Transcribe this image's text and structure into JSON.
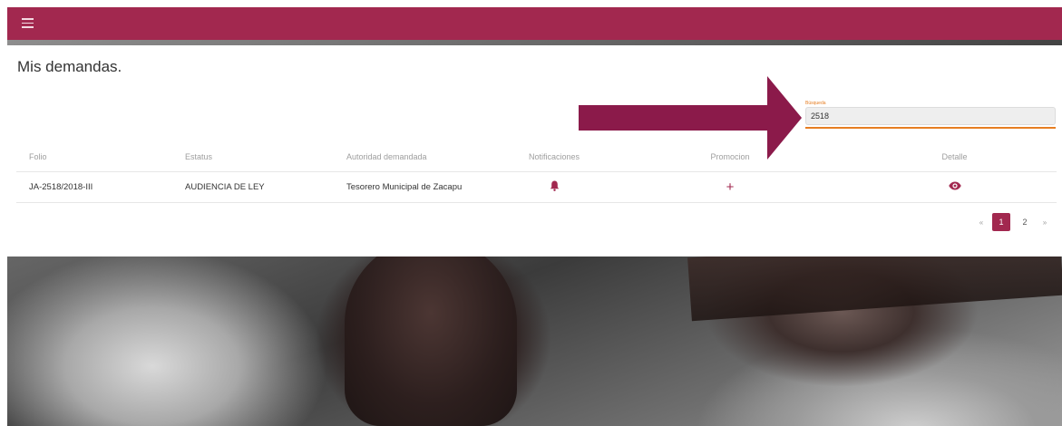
{
  "appbar": {
    "menu_icon": "hamburger-menu-icon",
    "color": "#a2284f"
  },
  "page": {
    "title": "Mis demandas."
  },
  "search": {
    "label": "Búsqueda",
    "value": "2518",
    "accent": "#e67e22"
  },
  "annotation": {
    "arrow_color": "#8b1a4a"
  },
  "table": {
    "headers": [
      "Folio",
      "Estatus",
      "Autoridad demandada",
      "Notificaciones",
      "Promocion",
      "Detalle"
    ],
    "rows": [
      {
        "folio": "JA-2518/2018-III",
        "estatus": "AUDIENCIA DE LEY",
        "autoridad": "Tesorero Municipal de Zacapu",
        "notificaciones_icon": "bell-icon",
        "promocion_icon": "plus-icon",
        "promocion_glyph": "+",
        "detalle_icon": "eye-icon"
      }
    ]
  },
  "pagination": {
    "prev": "«",
    "pages": [
      "1",
      "2"
    ],
    "current": "1",
    "next": "»"
  }
}
